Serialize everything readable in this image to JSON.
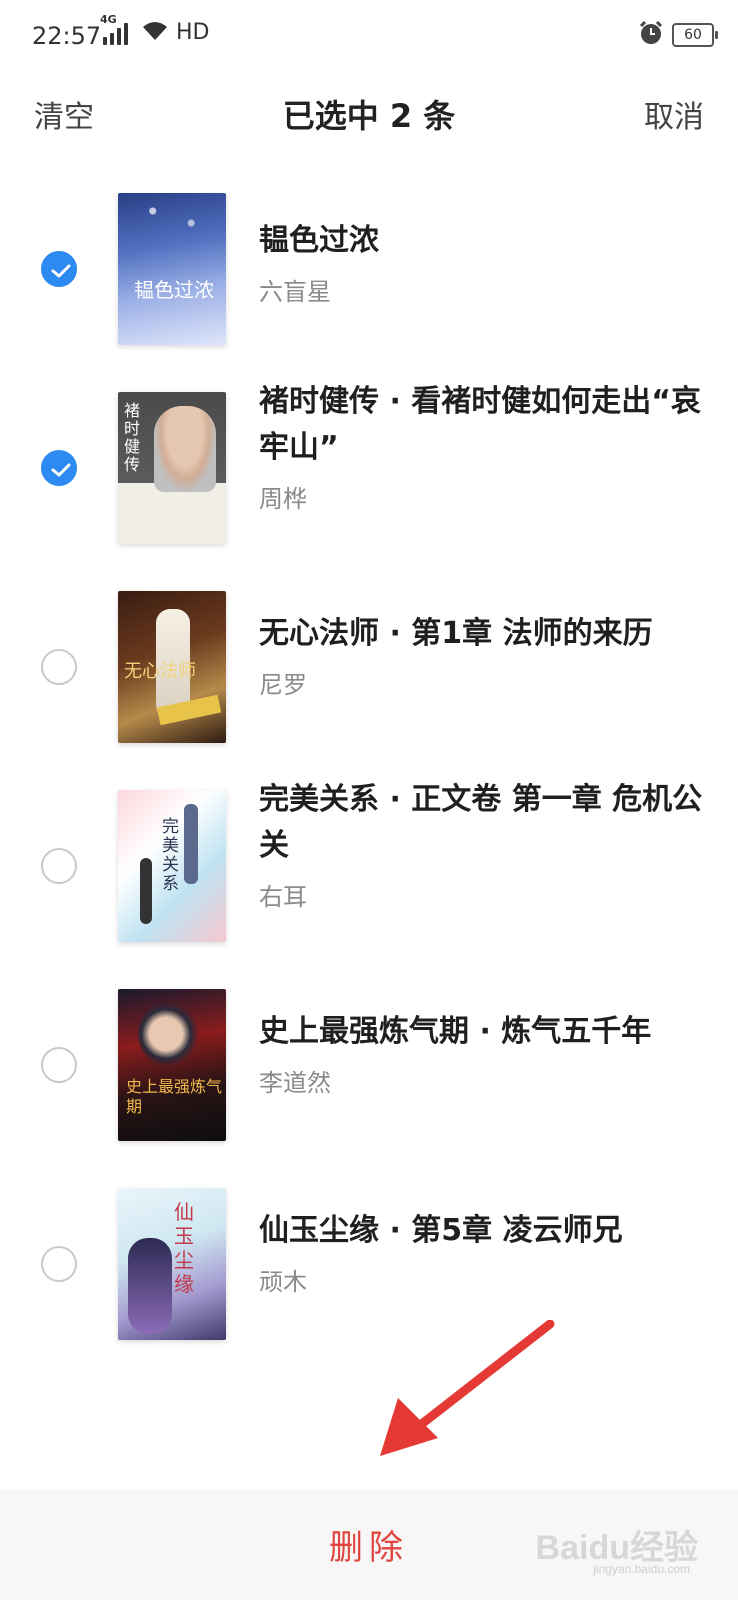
{
  "status_bar": {
    "time": "22:57",
    "network": "4G",
    "hd": "HD",
    "battery": "60"
  },
  "header": {
    "clear_label": "清空",
    "title": "已选中 2 条",
    "cancel_label": "取消"
  },
  "books": [
    {
      "title": "韫色过浓",
      "author": "六盲星",
      "selected": true,
      "cover_text": "韫色过浓"
    },
    {
      "title": "褚时健传 · 看褚时健如何走出“哀牢山”",
      "author": "周桦",
      "selected": true,
      "cover_text": "褚时健传"
    },
    {
      "title": "无心法师 · 第1章 法师的来历",
      "author": "尼罗",
      "selected": false,
      "cover_text": "无心法师"
    },
    {
      "title": "完美关系 · 正文卷 第一章 危机公关",
      "author": "右耳",
      "selected": false,
      "cover_text": "完美关系"
    },
    {
      "title": "史上最强炼气期 · 炼气五千年",
      "author": "李道然",
      "selected": false,
      "cover_text": "史上最强炼气期"
    },
    {
      "title": "仙玉尘缘 · 第5章 凌云师兄",
      "author": "顽木",
      "selected": false,
      "cover_text": "仙玉尘缘"
    }
  ],
  "footer": {
    "delete_label": "删除"
  },
  "watermark": {
    "brand": "Baidu经验",
    "url": "jingyan.baidu.com"
  },
  "colors": {
    "accent": "#2c8af1",
    "delete": "#e0463f",
    "arrow": "#e53935"
  }
}
